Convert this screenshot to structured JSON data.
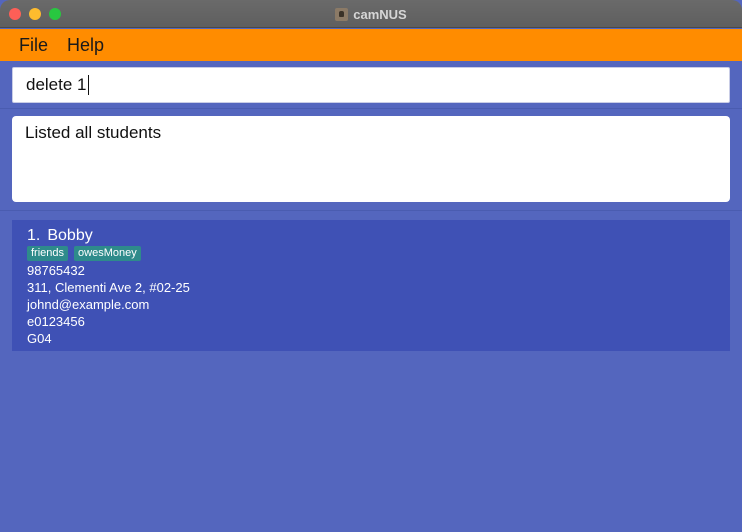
{
  "window": {
    "title": "camNUS"
  },
  "menu": {
    "file": "File",
    "help": "Help"
  },
  "command": {
    "value": "delete 1"
  },
  "result": {
    "message": "Listed all students"
  },
  "students": [
    {
      "index": "1.",
      "name": "Bobby",
      "tags": [
        "friends",
        "owesMoney"
      ],
      "phone": "98765432",
      "address": "311, Clementi Ave 2, #02-25",
      "email": "johnd@example.com",
      "student_id": "e0123456",
      "group": "G04"
    }
  ],
  "colors": {
    "menubar": "#ff8c00",
    "background": "#5466be",
    "card": "#3f51b5",
    "tag": "#2e8b8b"
  }
}
